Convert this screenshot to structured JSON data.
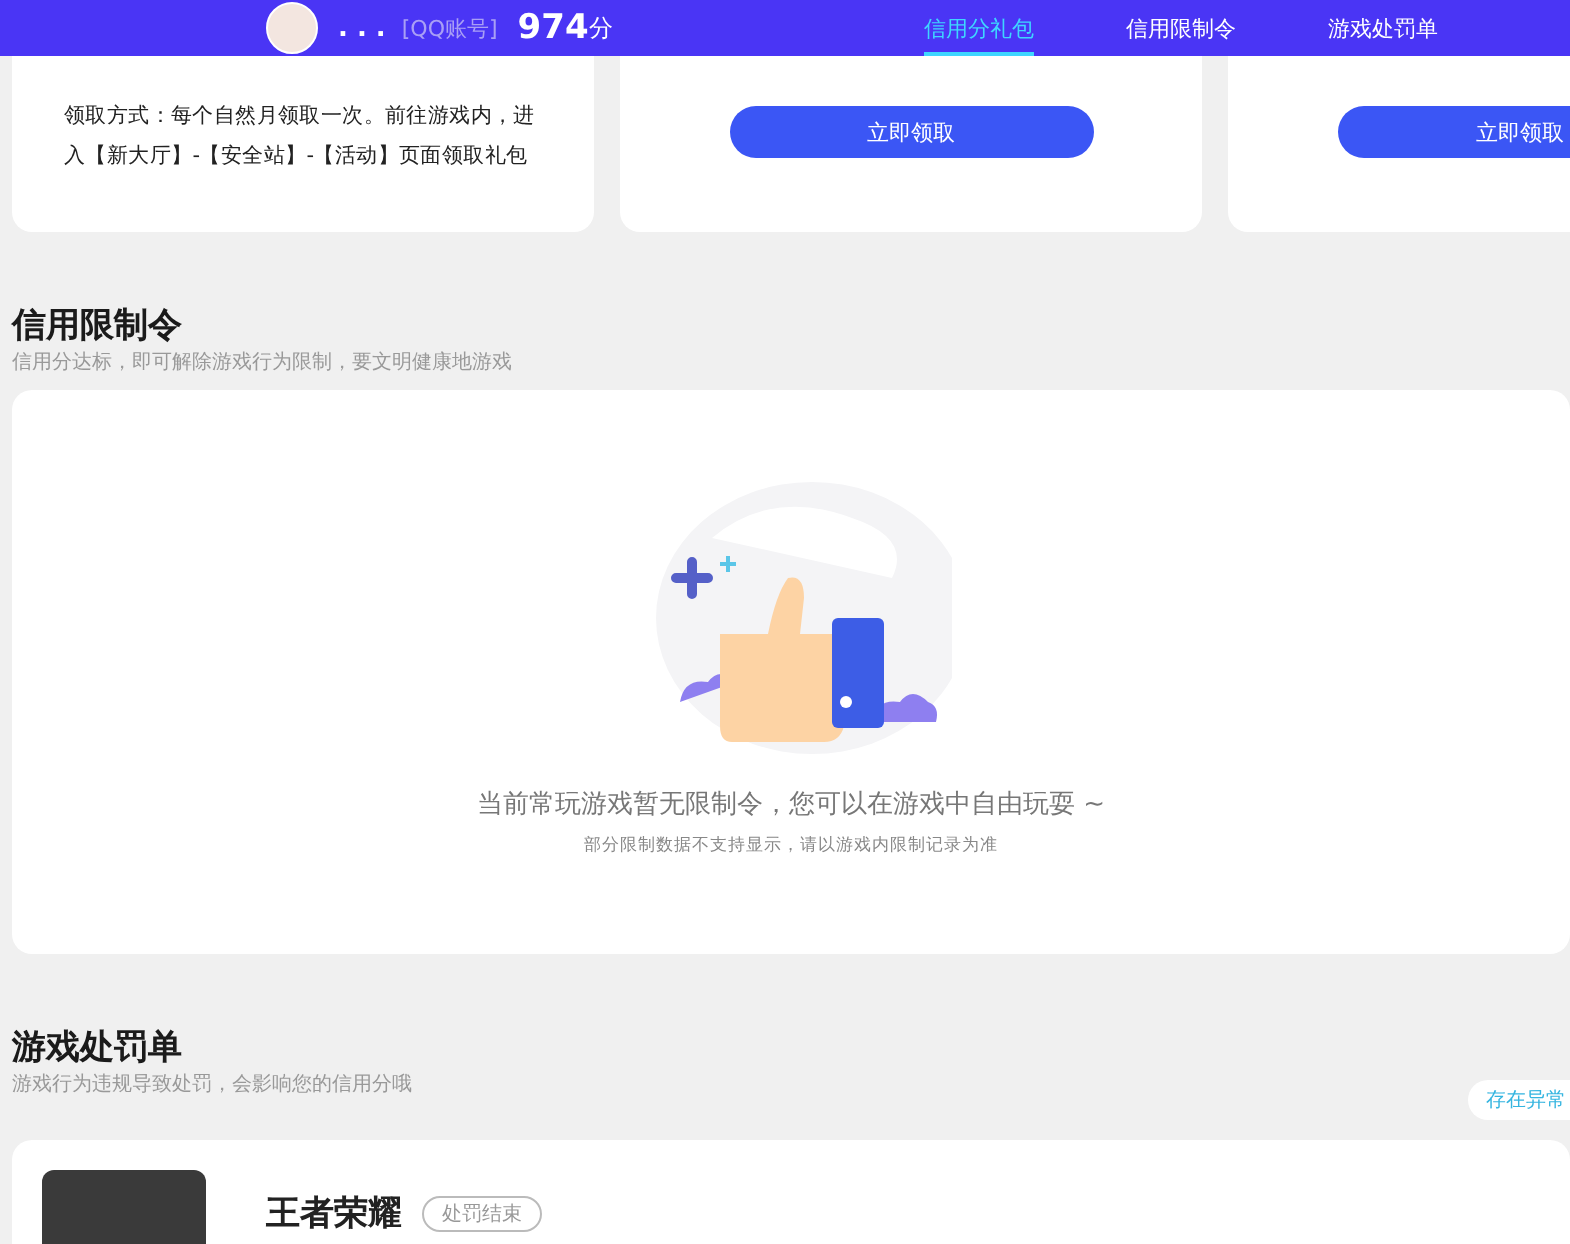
{
  "header": {
    "nickname": ". . .",
    "account_type": "[QQ账号]",
    "score": "974",
    "score_unit": "分",
    "tabs": [
      {
        "label": "信用分礼包",
        "selected": true
      },
      {
        "label": "信用限制令",
        "selected": false
      },
      {
        "label": "游戏处罚单",
        "selected": false
      }
    ]
  },
  "gift_cards": [
    {
      "kind": "text",
      "text": "领取方式：每个自然月领取一次。前往游戏内，进入【新大厅】-【安全站】-【活动】页面领取礼包"
    },
    {
      "kind": "button",
      "button": "立即领取"
    },
    {
      "kind": "button",
      "button": "立即领取"
    }
  ],
  "restriction": {
    "title": "信用限制令",
    "subtitle": "信用分达标，即可解除游戏行为限制，要文明健康地游戏",
    "empty_message": "当前常玩游戏暂无限制令，您可以在游戏中自由玩耍 ~",
    "note": "部分限制数据不支持显示，请以游戏内限制记录为准"
  },
  "penalty": {
    "title": "游戏处罚单",
    "subtitle": "游戏行为违规导致处罚，会影响您的信用分哦",
    "action": "存在异常",
    "items": [
      {
        "game": "王者荣耀",
        "status": "处罚结束"
      }
    ]
  }
}
